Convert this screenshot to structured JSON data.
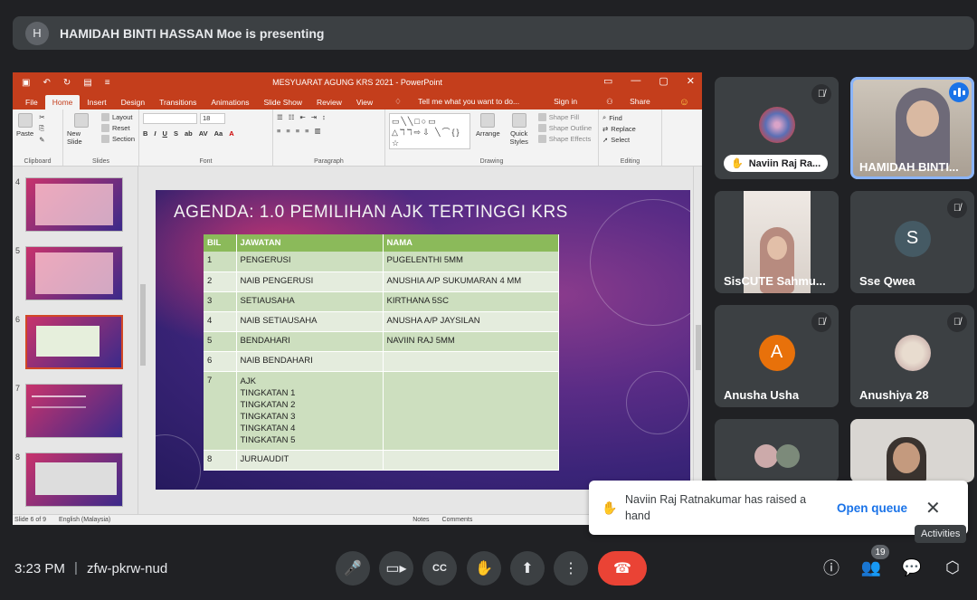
{
  "presenter": {
    "initial": "H",
    "text": "HAMIDAH BINTI HASSAN Moe is presenting"
  },
  "ppt": {
    "window_title": "MESYUARAT AGUNG KRS 2021 - PowerPoint",
    "menu": [
      "File",
      "Home",
      "Insert",
      "Design",
      "Transitions",
      "Animations",
      "Slide Show",
      "Review",
      "View"
    ],
    "tell_me": "Tell me what you want to do...",
    "sign_in": "Sign in",
    "share": "Share",
    "ribbon": {
      "paste": "Paste",
      "new_slide": "New Slide",
      "layout": "Layout",
      "reset": "Reset",
      "section": "Section",
      "font_size": "18",
      "arrange": "Arrange",
      "quick_styles": "Quick Styles",
      "shape_fill": "Shape Fill",
      "shape_outline": "Shape Outline",
      "shape_effects": "Shape Effects",
      "find": "Find",
      "replace": "Replace",
      "select": "Select",
      "groups": {
        "clipboard": "Clipboard",
        "slides": "Slides",
        "font": "Font",
        "paragraph": "Paragraph",
        "drawing": "Drawing",
        "editing": "Editing"
      }
    },
    "thumb_numbers": [
      "4",
      "5",
      "6",
      "7",
      "8"
    ],
    "slide": {
      "title": "AGENDA: 1.0 PEMILIHAN AJK TERTINGGI KRS",
      "headers": [
        "BIL",
        "JAWATAN",
        "NAMA"
      ],
      "rows": [
        [
          "1",
          "PENGERUSI",
          "PUGELENTHI 5MM"
        ],
        [
          "2",
          "NAIB PENGERUSI",
          "ANUSHIA A/P SUKUMARAN 4 MM"
        ],
        [
          "3",
          "SETIAUSAHA",
          "KIRTHANA 5SC"
        ],
        [
          "4",
          "NAIB SETIAUSAHA",
          "ANUSHA A/P JAYSILAN"
        ],
        [
          "5",
          "BENDAHARI",
          "NAVIIN RAJ 5MM"
        ],
        [
          "6",
          "NAIB BENDAHARI",
          ""
        ],
        [
          "7",
          "AJK\nTINGKATAN 1\nTINGKATAN 2\nTINGKATAN 3\nTINGKATAN 4\nTINGKATAN 5",
          ""
        ],
        [
          "8",
          "JURUAUDIT",
          ""
        ]
      ]
    },
    "status": {
      "slide": "Slide 6 of 9",
      "lang": "English (Malaysia)",
      "notes": "Notes",
      "comments": "Comments"
    }
  },
  "participants": {
    "naviin": "Naviin Raj Ra...",
    "hamidah": "HAMIDAH BINTI...",
    "sis": "SisCUTE Sahmu...",
    "sse": {
      "initial": "S",
      "name": "Sse Qwea"
    },
    "anusha": {
      "initial": "A",
      "name": "Anusha Usha"
    },
    "anushiya": "Anushiya 28"
  },
  "toast": {
    "message": "Naviin Raj Ratnakumar has raised a hand",
    "link": "Open queue"
  },
  "tooltip": "Activities",
  "bottom": {
    "time": "3:23 PM",
    "separator": "|",
    "code": "zfw-pkrw-nud",
    "people_count": "19"
  },
  "colors": {
    "end_call": "#ea4335",
    "accent": "#1a73e8",
    "ppt": "#c43e1c"
  }
}
